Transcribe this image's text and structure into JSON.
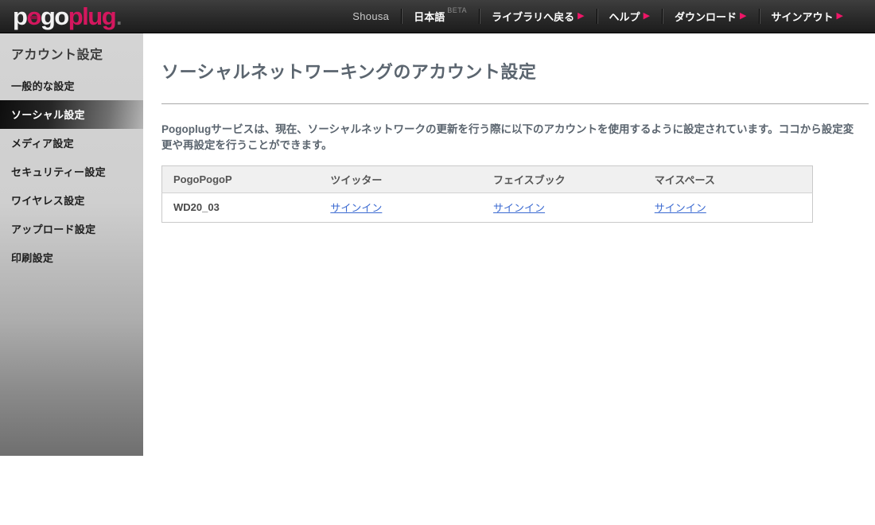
{
  "colors": {
    "accent_pink": "#d4175e",
    "nav_arrow_pink": "#ee1667",
    "link_blue": "#3b6ad1"
  },
  "topbar": {
    "logo": {
      "p": "p",
      "o": "o",
      "go": "go",
      "plug": "plug",
      "dot": "."
    },
    "username": "Shousa",
    "language": "日本語",
    "language_beta": "BETA",
    "arrow_glyph": "▶",
    "nav": [
      {
        "label": "ライブラリへ戻る"
      },
      {
        "label": "ヘルプ"
      },
      {
        "label": "ダウンロード"
      },
      {
        "label": "サインアウト"
      }
    ]
  },
  "sidebar": {
    "header": "アカウント設定",
    "selected_index": 1,
    "items": [
      {
        "label": "一般的な設定"
      },
      {
        "label": "ソーシャル設定"
      },
      {
        "label": "メディア設定"
      },
      {
        "label": "セキュリティー設定"
      },
      {
        "label": "ワイヤレス設定"
      },
      {
        "label": "アップロード設定"
      },
      {
        "label": "印刷設定"
      }
    ]
  },
  "main": {
    "title": "ソーシャルネットワーキングのアカウント設定",
    "description": "Pogoplugサービスは、現在、ソーシャルネットワークの更新を行う際に以下のアカウントを使用するように設定されています。ココから設定変更や再設定を行うことができます。",
    "table": {
      "columns": [
        "PogoPogoP",
        "ツイッター",
        "フェイスブック",
        "マイスペース"
      ],
      "rows": [
        {
          "device": "WD20_03",
          "twitter_link": "サインイン",
          "facebook_link": "サインイン",
          "myspace_link": "サインイン"
        }
      ]
    }
  }
}
